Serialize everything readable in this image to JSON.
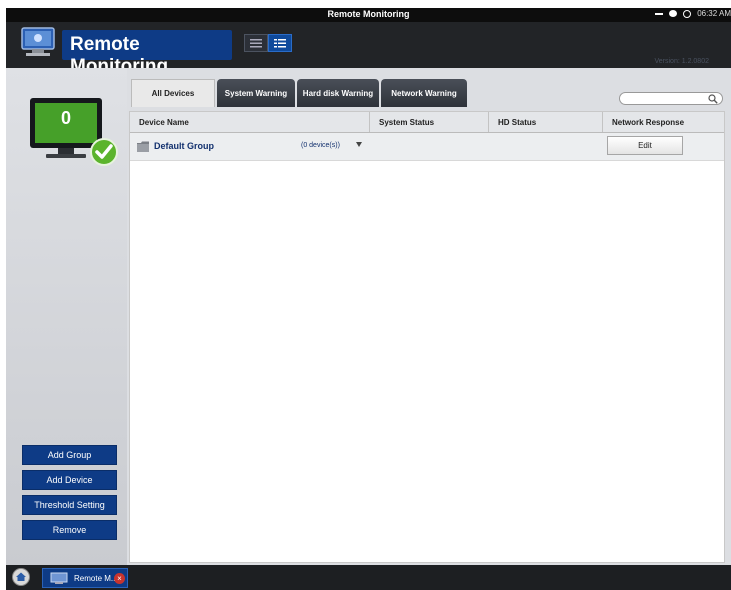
{
  "window": {
    "title": "Remote Monitoring",
    "time": "06:32 AM"
  },
  "header": {
    "app_title": "Remote Monitoring",
    "version": "Version: 1.2.0802"
  },
  "status": {
    "device_count": "0"
  },
  "tabs": [
    {
      "label": "All Devices",
      "active": true
    },
    {
      "label": "System Warning",
      "active": false
    },
    {
      "label": "Hard disk Warning",
      "active": false
    },
    {
      "label": "Network Warning",
      "active": false
    }
  ],
  "search": {
    "placeholder": ""
  },
  "table": {
    "columns": [
      "Device Name",
      "System Status",
      "HD Status",
      "Network Response"
    ],
    "rows": [
      {
        "name": "Default Group",
        "count": "(0 device(s))",
        "action": "Edit"
      }
    ]
  },
  "sidebar": {
    "buttons": [
      "Add Group",
      "Add Device",
      "Threshold Setting",
      "Remove"
    ]
  },
  "taskbar": {
    "item_label": "Remote M..",
    "close_glyph": "×"
  },
  "icons": [
    "minimize-icon",
    "chat-icon",
    "power-icon",
    "list-view-icon",
    "detail-view-icon",
    "search-icon",
    "folder-icon",
    "chevron-down-icon",
    "home-icon",
    "check-icon"
  ],
  "colors": {
    "accent": "#0e3b86",
    "header_bg": "#222427",
    "sysbar_bg": "#0d0d0d",
    "ok_green": "#46a029"
  }
}
